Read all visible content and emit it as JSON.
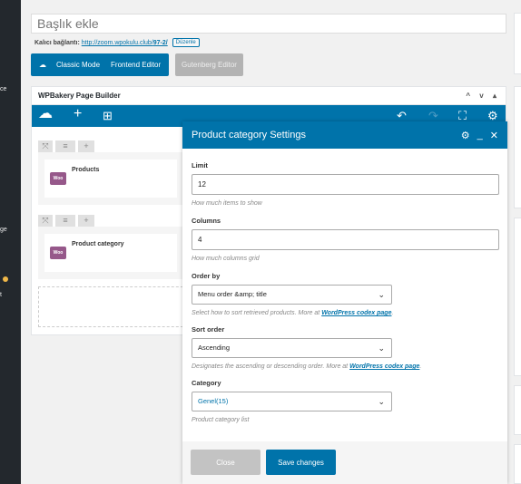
{
  "sidebar": {
    "fragments": [
      "ce",
      "ge",
      "t"
    ]
  },
  "post": {
    "title_placeholder": "Başlık ekle",
    "permalink_label": "Kalıcı bağlantı:",
    "permalink_url_base": "http://zoom.wpokulu.club/",
    "permalink_slug": "97-2/",
    "edit_label": "Düzenle"
  },
  "mode_buttons": {
    "classic": "Classic Mode",
    "frontend": "Frontend Editor",
    "gutenberg": "Gutenberg Editor"
  },
  "wpbakery": {
    "box_title": "WPBakery Page Builder",
    "box_arrows": "^ v ▴",
    "rows": [
      {
        "element_title": "Products",
        "badge": "Woo"
      },
      {
        "element_title": "Product category",
        "badge": "Woo"
      }
    ]
  },
  "modal": {
    "title": "Product category Settings",
    "fields": {
      "limit": {
        "label": "Limit",
        "value": "12",
        "help": "How much items to show"
      },
      "columns": {
        "label": "Columns",
        "value": "4",
        "help": "How much columns grid"
      },
      "order_by": {
        "label": "Order by",
        "value": "Menu order &amp; title",
        "help": "Select how to sort retrieved products. More at ",
        "help_link": "WordPress codex page",
        "help_end": "."
      },
      "sort_order": {
        "label": "Sort order",
        "value": "Ascending",
        "help": "Designates the ascending or descending order. More at ",
        "help_link": "WordPress codex page",
        "help_end": "."
      },
      "category": {
        "label": "Category",
        "value": "Genel(15)",
        "help": "Product category list"
      }
    },
    "close_label": "Close",
    "save_label": "Save changes"
  },
  "colors": {
    "accent": "#0073aa",
    "woo": "#96588a",
    "admin_bar": "#23282d"
  }
}
